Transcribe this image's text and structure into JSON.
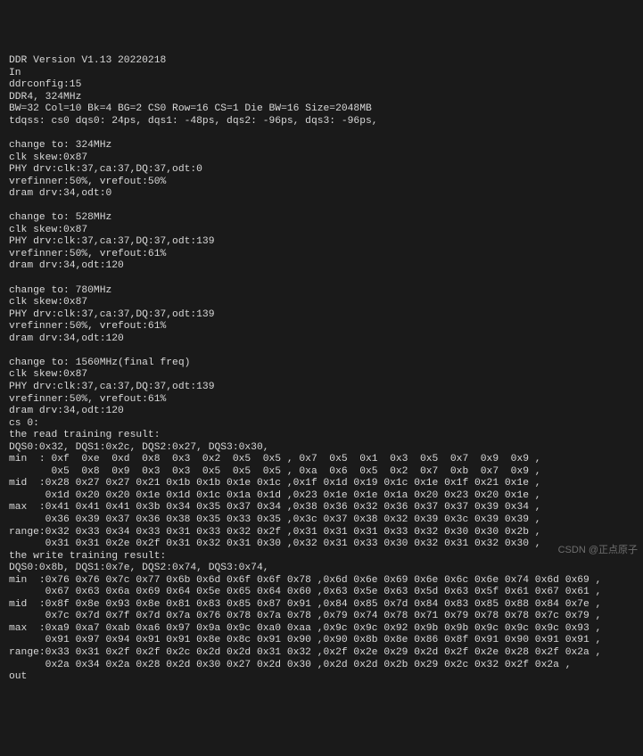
{
  "terminal": {
    "lines": [
      "DDR Version V1.13 20220218",
      "In",
      "ddrconfig:15",
      "DDR4, 324MHz",
      "BW=32 Col=10 Bk=4 BG=2 CS0 Row=16 CS=1 Die BW=16 Size=2048MB",
      "tdqss: cs0 dqs0: 24ps, dqs1: -48ps, dqs2: -96ps, dqs3: -96ps,",
      "",
      "change to: 324MHz",
      "clk skew:0x87",
      "PHY drv:clk:37,ca:37,DQ:37,odt:0",
      "vrefinner:50%, vrefout:50%",
      "dram drv:34,odt:0",
      "",
      "change to: 528MHz",
      "clk skew:0x87",
      "PHY drv:clk:37,ca:37,DQ:37,odt:139",
      "vrefinner:50%, vrefout:61%",
      "dram drv:34,odt:120",
      "",
      "change to: 780MHz",
      "clk skew:0x87",
      "PHY drv:clk:37,ca:37,DQ:37,odt:139",
      "vrefinner:50%, vrefout:61%",
      "dram drv:34,odt:120",
      "",
      "change to: 1560MHz(final freq)",
      "clk skew:0x87",
      "PHY drv:clk:37,ca:37,DQ:37,odt:139",
      "vrefinner:50%, vrefout:61%",
      "dram drv:34,odt:120",
      "cs 0:",
      "the read training result:",
      "DQS0:0x32, DQS1:0x2c, DQS2:0x27, DQS3:0x30,",
      "min  : 0xf  0xe  0xd  0x8  0x3  0x2  0x5  0x5 , 0x7  0x5  0x1  0x3  0x5  0x7  0x9  0x9 ,",
      "       0x5  0x8  0x9  0x3  0x3  0x5  0x5  0x5 , 0xa  0x6  0x5  0x2  0x7  0xb  0x7  0x9 ,",
      "mid  :0x28 0x27 0x27 0x21 0x1b 0x1b 0x1e 0x1c ,0x1f 0x1d 0x19 0x1c 0x1e 0x1f 0x21 0x1e ,",
      "      0x1d 0x20 0x20 0x1e 0x1d 0x1c 0x1a 0x1d ,0x23 0x1e 0x1e 0x1a 0x20 0x23 0x20 0x1e ,",
      "max  :0x41 0x41 0x41 0x3b 0x34 0x35 0x37 0x34 ,0x38 0x36 0x32 0x36 0x37 0x37 0x39 0x34 ,",
      "      0x36 0x39 0x37 0x36 0x38 0x35 0x33 0x35 ,0x3c 0x37 0x38 0x32 0x39 0x3c 0x39 0x39 ,",
      "range:0x32 0x33 0x34 0x33 0x31 0x33 0x32 0x2f ,0x31 0x31 0x31 0x33 0x32 0x30 0x30 0x2b ,",
      "      0x31 0x31 0x2e 0x2f 0x31 0x32 0x31 0x30 ,0x32 0x31 0x33 0x30 0x32 0x31 0x32 0x30 ,",
      "the write training result:",
      "DQS0:0x8b, DQS1:0x7e, DQS2:0x74, DQS3:0x74,",
      "min  :0x76 0x76 0x7c 0x77 0x6b 0x6d 0x6f 0x6f 0x78 ,0x6d 0x6e 0x69 0x6e 0x6c 0x6e 0x74 0x6d 0x69 ,",
      "      0x67 0x63 0x6a 0x69 0x64 0x5e 0x65 0x64 0x60 ,0x63 0x5e 0x63 0x5d 0x63 0x5f 0x61 0x67 0x61 ,",
      "mid  :0x8f 0x8e 0x93 0x8e 0x81 0x83 0x85 0x87 0x91 ,0x84 0x85 0x7d 0x84 0x83 0x85 0x88 0x84 0x7e ,",
      "      0x7c 0x7d 0x7f 0x7d 0x7a 0x76 0x78 0x7a 0x78 ,0x79 0x74 0x78 0x71 0x79 0x78 0x78 0x7c 0x79 ,",
      "max  :0xa9 0xa7 0xab 0xa6 0x97 0x9a 0x9c 0xa0 0xaa ,0x9c 0x9c 0x92 0x9b 0x9b 0x9c 0x9c 0x9c 0x93 ,",
      "      0x91 0x97 0x94 0x91 0x91 0x8e 0x8c 0x91 0x90 ,0x90 0x8b 0x8e 0x86 0x8f 0x91 0x90 0x91 0x91 ,",
      "range:0x33 0x31 0x2f 0x2f 0x2c 0x2d 0x2d 0x31 0x32 ,0x2f 0x2e 0x29 0x2d 0x2f 0x2e 0x28 0x2f 0x2a ,",
      "      0x2a 0x34 0x2a 0x28 0x2d 0x30 0x27 0x2d 0x30 ,0x2d 0x2d 0x2b 0x29 0x2c 0x32 0x2f 0x2a ,",
      "out"
    ]
  },
  "watermark": {
    "text": "CSDN @正点原子"
  }
}
